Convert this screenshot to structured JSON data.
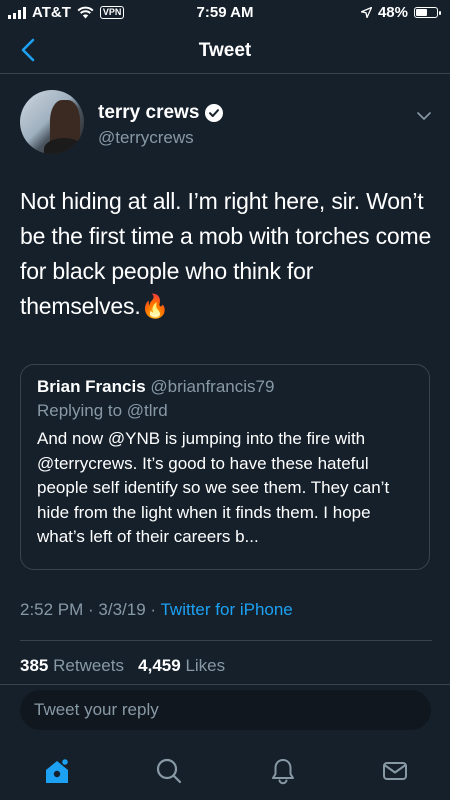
{
  "status_bar": {
    "carrier": "AT&T",
    "vpn": "VPN",
    "time": "7:59 AM",
    "battery": "48%",
    "battery_level": 0.48
  },
  "nav": {
    "title": "Tweet",
    "back_icon": "chevron-left-icon"
  },
  "tweet": {
    "author_name": "terry crews",
    "author_handle": "@terrycrews",
    "text": "Not hiding at all. I’m right here, sir. Won’t be the first time a mob with torches come for black people who think for themselves.🔥",
    "timestamp": "2:52 PM · 3/3/19 · ",
    "source": "Twitter for iPhone",
    "retweets_count": "385",
    "retweets_label": "Retweets",
    "likes_count": "4,459",
    "likes_label": "Likes"
  },
  "quoted_tweet": {
    "author_name": "Brian Francis",
    "author_handle": "@brianfrancis79",
    "replying_to": "Replying to @tlrd",
    "text": "And now @YNB is jumping into the fire with @terrycrews. It’s good to have these hateful people self identify so we see them. They can’t hide from the light when it finds them. I hope what’s left of their careers b..."
  },
  "reply": {
    "placeholder": "Tweet your reply"
  },
  "tabs": [
    "home-icon",
    "search-icon",
    "notifications-icon",
    "messages-icon"
  ],
  "colors": {
    "background": "#15202b",
    "accent": "#1da1f2",
    "secondary_text": "#8899a6",
    "divider": "#38444d"
  }
}
